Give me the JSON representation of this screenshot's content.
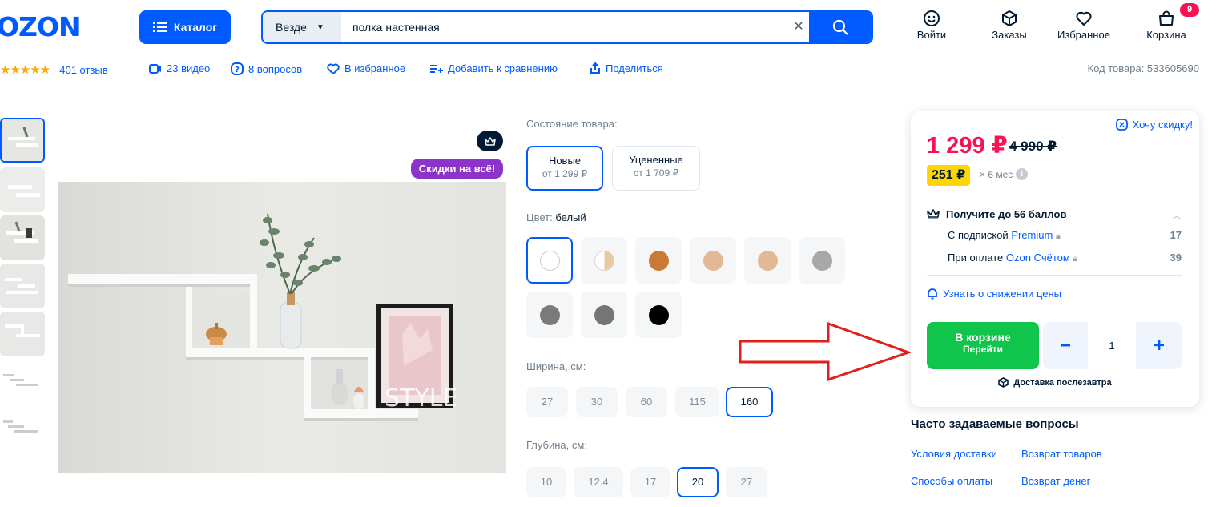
{
  "header": {
    "logo": "OZON",
    "catalog_label": "Каталог",
    "search_scope": "Везде",
    "search_value": "полка настенная",
    "nav": {
      "login": "Войти",
      "orders": "Заказы",
      "favorites": "Избранное",
      "cart": "Корзина",
      "cart_count": "9"
    }
  },
  "info_row": {
    "reviews": "401 отзыв",
    "videos": "23 видео",
    "questions": "8 вопросов",
    "favorite": "В избранное",
    "compare": "Добавить к сравнению",
    "share": "Поделиться",
    "sku": "Код товара: 533605690"
  },
  "media": {
    "sale_badge": "Скидки на всё!",
    "image_watermark": "STYLE"
  },
  "condition": {
    "label": "Состояние товара:",
    "options": [
      {
        "title": "Новые",
        "sub": "от 1 299 ₽"
      },
      {
        "title": "Уцененные",
        "sub": "от 1 709 ₽"
      }
    ]
  },
  "color": {
    "label": "Цвет:",
    "value": "белый",
    "swatches": [
      "#ffffff",
      "#e8c9a0",
      "#c97b35",
      "#e3b995",
      "#e3b995",
      "#a8a8a8",
      "#7a7a7a",
      "#757575",
      "#000000"
    ]
  },
  "width": {
    "label": "Ширина, см:",
    "options": [
      "27",
      "30",
      "60",
      "115",
      "160"
    ],
    "selected": "160"
  },
  "depth": {
    "label": "Глубина, см:",
    "options": [
      "10",
      "12.4",
      "17",
      "20",
      "27"
    ],
    "selected": "20"
  },
  "price_card": {
    "want_discount": "Хочу скидку!",
    "price": "1 299 ₽",
    "old_price": "4 990 ₽",
    "installment": "251 ₽",
    "installment_period": "× 6 мес",
    "points_title": "Получите до 56 баллов",
    "points": [
      {
        "text": "С подпиской",
        "link": "Premium",
        "value": "17"
      },
      {
        "text": "При оплате",
        "link": "Ozon Счётом",
        "value": "39"
      }
    ],
    "price_alert": "Узнать о снижении цены",
    "cart_button_line1": "В корзине",
    "cart_button_line2": "Перейти",
    "quantity": "1",
    "minus": "−",
    "plus": "+",
    "delivery": "Доставка послезавтра"
  },
  "faq": {
    "title": "Часто задаваемые вопросы",
    "links": [
      "Условия доставки",
      "Возврат товаров",
      "Способы оплаты",
      "Возврат денег"
    ]
  },
  "colors": {
    "brand": "#005bff",
    "price": "#f91155",
    "cart_green": "#10c44c",
    "sale_purple": "#8c34c9",
    "installment_yellow": "#ffd600",
    "annotation_red": "#e0201a"
  }
}
